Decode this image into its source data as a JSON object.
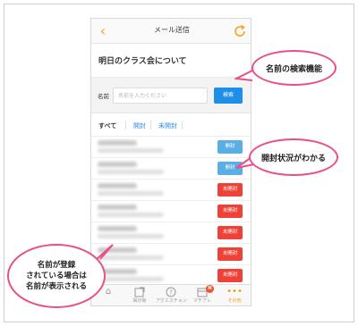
{
  "navbar": {
    "title": "メール送信"
  },
  "subject": "明日のクラス会について",
  "search": {
    "label": "名前",
    "placeholder": "名前を入力ください",
    "button": "検索"
  },
  "filter_tabs": [
    {
      "label": "すべて",
      "active": true
    },
    {
      "label": "開封",
      "active": false
    },
    {
      "label": "未開封",
      "active": false
    }
  ],
  "recipients": [
    {
      "status": "開封",
      "color": "#5aaee6"
    },
    {
      "status": "開封",
      "color": "#5aaee6"
    },
    {
      "status": "未開封",
      "color": "#ef4135"
    },
    {
      "status": "未開封",
      "color": "#ef4135"
    },
    {
      "status": "未開封",
      "color": "#ef4135"
    },
    {
      "status": "未開封",
      "color": "#ef4135"
    },
    {
      "status": "未開封",
      "color": "#ef4135"
    }
  ],
  "tabbar": [
    {
      "label": "",
      "icon": "home-icon",
      "active": false
    },
    {
      "label": "掲示板",
      "icon": "bulletin-board-icon",
      "active": false
    },
    {
      "label": "アクエスチョン",
      "icon": "question-icon",
      "active": false
    },
    {
      "label": "マチアレ",
      "icon": "calendar-icon",
      "active": false,
      "badge": "N"
    },
    {
      "label": "その他",
      "icon": "more-icon",
      "active": true
    }
  ],
  "callouts": {
    "search_feature": "名前の検索機能",
    "open_status": "開封状況がわかる",
    "name_display": [
      "名前が登録",
      "されている場合は",
      "名前が表示される"
    ]
  },
  "colors": {
    "accent": "#f6a31d",
    "primary_blue": "#1f8ee8",
    "open_blue": "#5aaee6",
    "unopened_red": "#ef4135",
    "callout_pink": "#e94e8a"
  }
}
